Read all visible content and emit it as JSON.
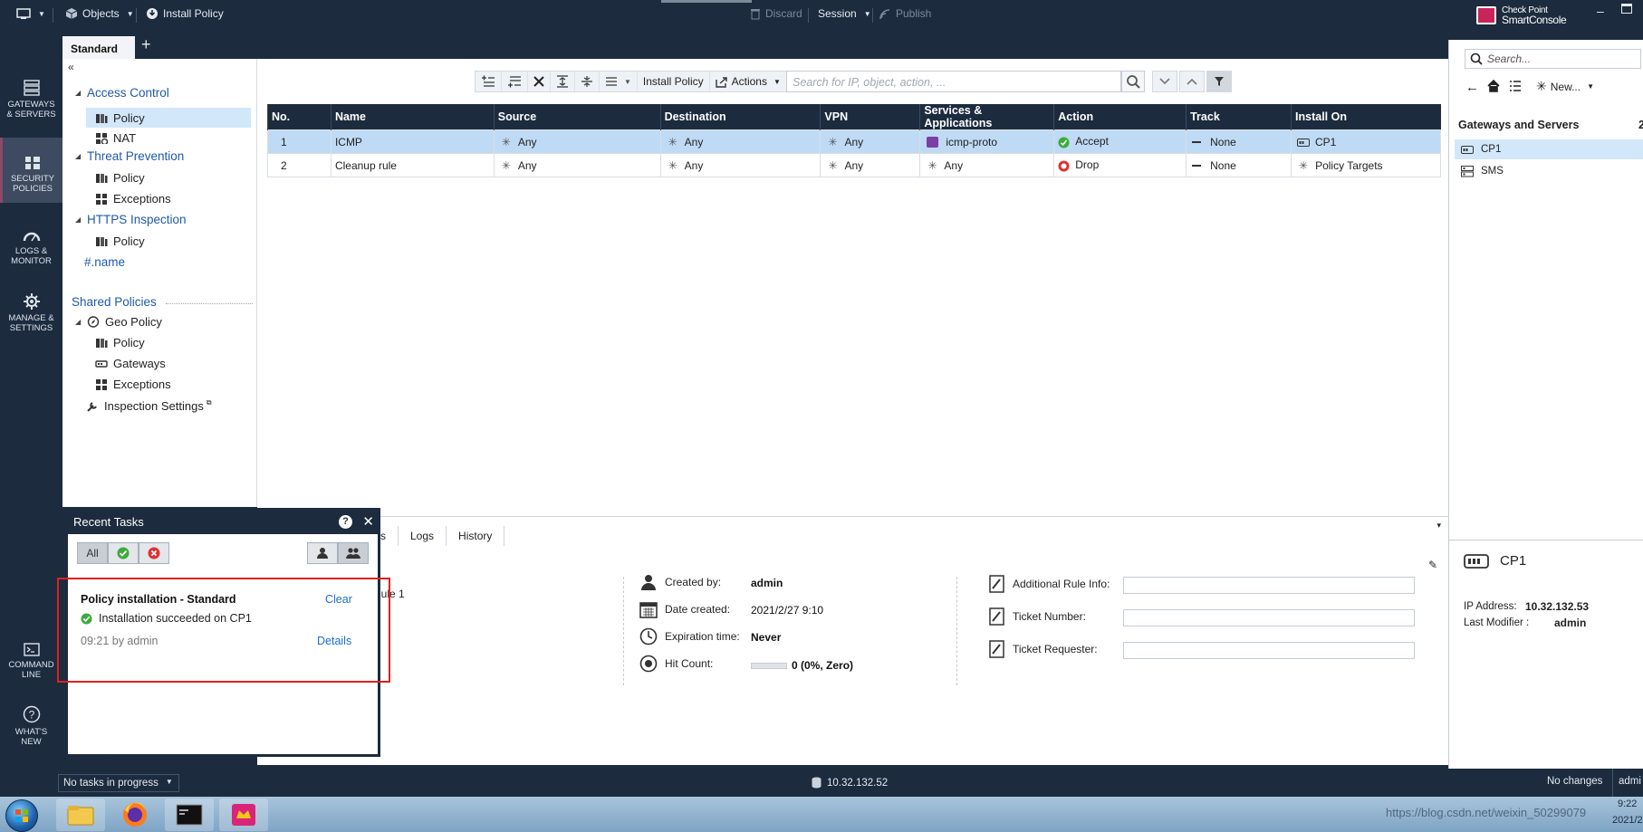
{
  "topbar": {
    "objects_label": "Objects",
    "install_policy_label": "Install Policy",
    "discard_label": "Discard",
    "session_label": "Session",
    "publish_label": "Publish",
    "logo_line1": "Check Point",
    "logo_line2": "SmartConsole"
  },
  "leftnav": {
    "gateways": [
      "GATEWAYS",
      "& SERVERS"
    ],
    "security": [
      "SECURITY",
      "POLICIES"
    ],
    "logs": [
      "LOGS &",
      "MONITOR"
    ],
    "manage": [
      "MANAGE &",
      "SETTINGS"
    ],
    "command": [
      "COMMAND",
      "LINE"
    ],
    "whatsnew": [
      "WHAT'S",
      "NEW"
    ]
  },
  "tabs": {
    "active": "Standard",
    "add": "+"
  },
  "tree": {
    "collapse": "«",
    "access_control": "Access Control",
    "ac_policy": "Policy",
    "ac_nat": "NAT",
    "threat_prevention": "Threat Prevention",
    "tp_policy": "Policy",
    "tp_exceptions": "Exceptions",
    "https_inspection": "HTTPS Inspection",
    "hi_policy": "Policy",
    "name_item": "#.name",
    "shared_policies": "Shared Policies",
    "geo_policy": "Geo Policy",
    "geo_policy_item": "Policy",
    "geo_gateways": "Gateways",
    "geo_exceptions": "Exceptions",
    "inspection_settings": "Inspection Settings"
  },
  "toolbar": {
    "install_policy": "Install Policy",
    "actions": "Actions",
    "search_placeholder": "Search for IP, object, action, ..."
  },
  "grid": {
    "columns": [
      "No.",
      "Name",
      "Source",
      "Destination",
      "VPN",
      "Services & Applications",
      "Action",
      "Track",
      "Install On"
    ],
    "rows": [
      {
        "no": "1",
        "name": "ICMP",
        "source": "Any",
        "destination": "Any",
        "vpn": "Any",
        "services": "icmp-proto",
        "action": "Accept",
        "track": "None",
        "install_on": "CP1"
      },
      {
        "no": "2",
        "name": "Cleanup rule",
        "source": "Any",
        "destination": "Any",
        "vpn": "Any",
        "services": "Any",
        "action": "Drop",
        "track": "None",
        "install_on": "Policy Targets"
      }
    ]
  },
  "details": {
    "tabs": [
      "s",
      "Logs",
      "History"
    ],
    "rule_text": "Rule 1",
    "created_by_label": "Created by:",
    "created_by": "admin",
    "date_created_label": "Date created:",
    "date_created": "2021/2/27 9:10",
    "expiration_label": "Expiration time:",
    "expiration": "Never",
    "hit_count_label": "Hit Count:",
    "hit_count": "0 (0%, Zero)",
    "additional_info_label": "Additional Rule Info:",
    "ticket_number_label": "Ticket Number:",
    "ticket_requester_label": "Ticket Requester:"
  },
  "tasks": {
    "title": "Recent Tasks",
    "help": "?",
    "close": "✕",
    "filter_all": "All",
    "task_title": "Policy installation - Standard",
    "clear": "Clear",
    "result": "Installation succeeded on CP1",
    "time": "09:21 by admin",
    "details": "Details"
  },
  "status": {
    "tasks_progress": "No tasks in progress",
    "server_ip": "10.32.132.52",
    "changes": "No changes",
    "user": "admi"
  },
  "right": {
    "search_placeholder": "Search...",
    "new_label": "New...",
    "section": "Gateways and Servers",
    "section_count": "2",
    "items": [
      "CP1",
      "SMS"
    ],
    "detail_name": "CP1",
    "ip_label": "IP Address:",
    "ip_value": "10.32.132.53",
    "modifier_label": "Last Modifier :",
    "modifier_value": "admin"
  },
  "taskbar": {
    "clock": "9:22",
    "date": "2021/2",
    "watermark": "https://blog.csdn.net/weixin_50299079"
  },
  "colors": {
    "chrome": "#1c2b3e",
    "selection": "#bfdaf4",
    "link": "#1e5aa8",
    "accept": "#3bab3b",
    "drop": "#e03131",
    "highlight_box": "#e02020"
  }
}
